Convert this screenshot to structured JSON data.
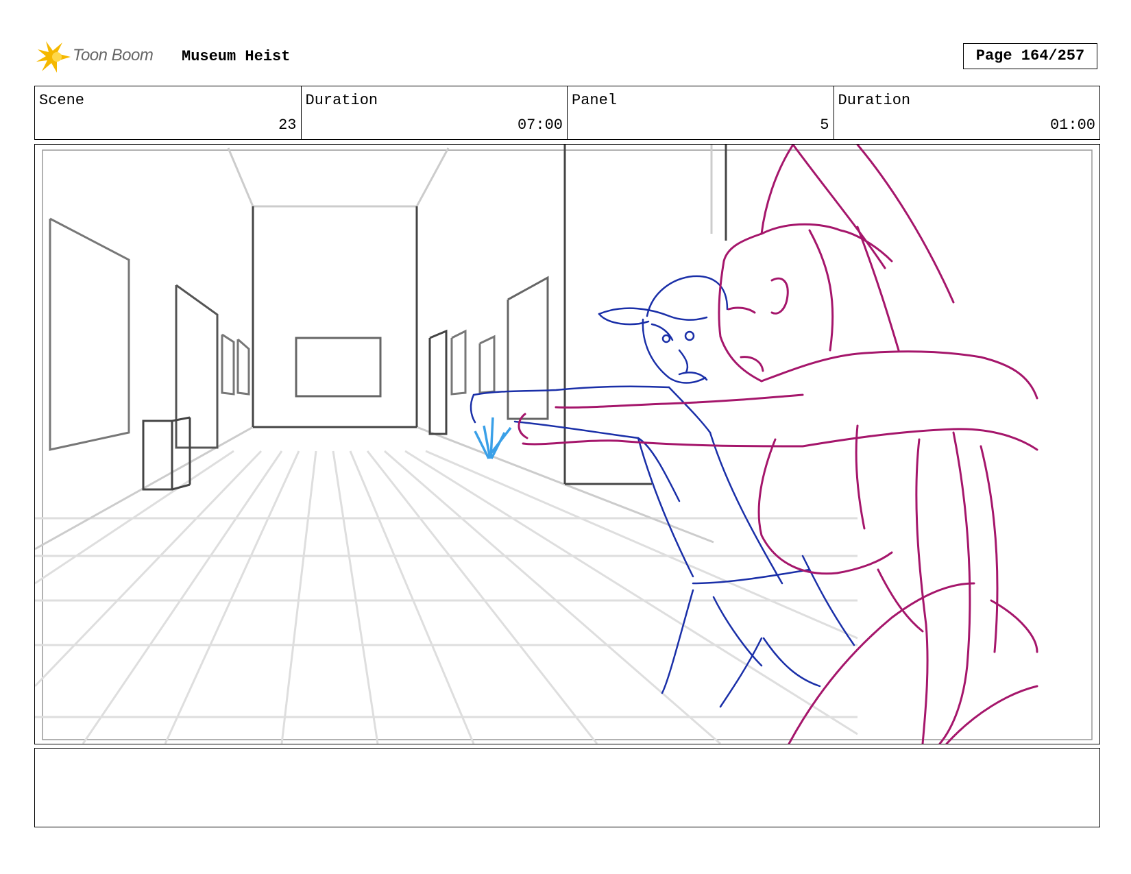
{
  "header": {
    "logo_text": "Toon Boom",
    "project_title": "Museum Heist",
    "page_label": "Page 164/257"
  },
  "info": {
    "scene_label": "Scene",
    "scene_value": "23",
    "scene_duration_label": "Duration",
    "scene_duration_value": "07:00",
    "panel_label": "Panel",
    "panel_value": "5",
    "panel_duration_label": "Duration",
    "panel_duration_value": "01:00"
  },
  "notes": {
    "text": ""
  },
  "colors": {
    "logo_accent": "#F5B800",
    "sketch_gray": "#dddddd",
    "sketch_dark": "#444444",
    "guard_blue": "#1a2fa8",
    "thief_magenta": "#a5166b",
    "effect_cyan": "#3aa0e8"
  }
}
